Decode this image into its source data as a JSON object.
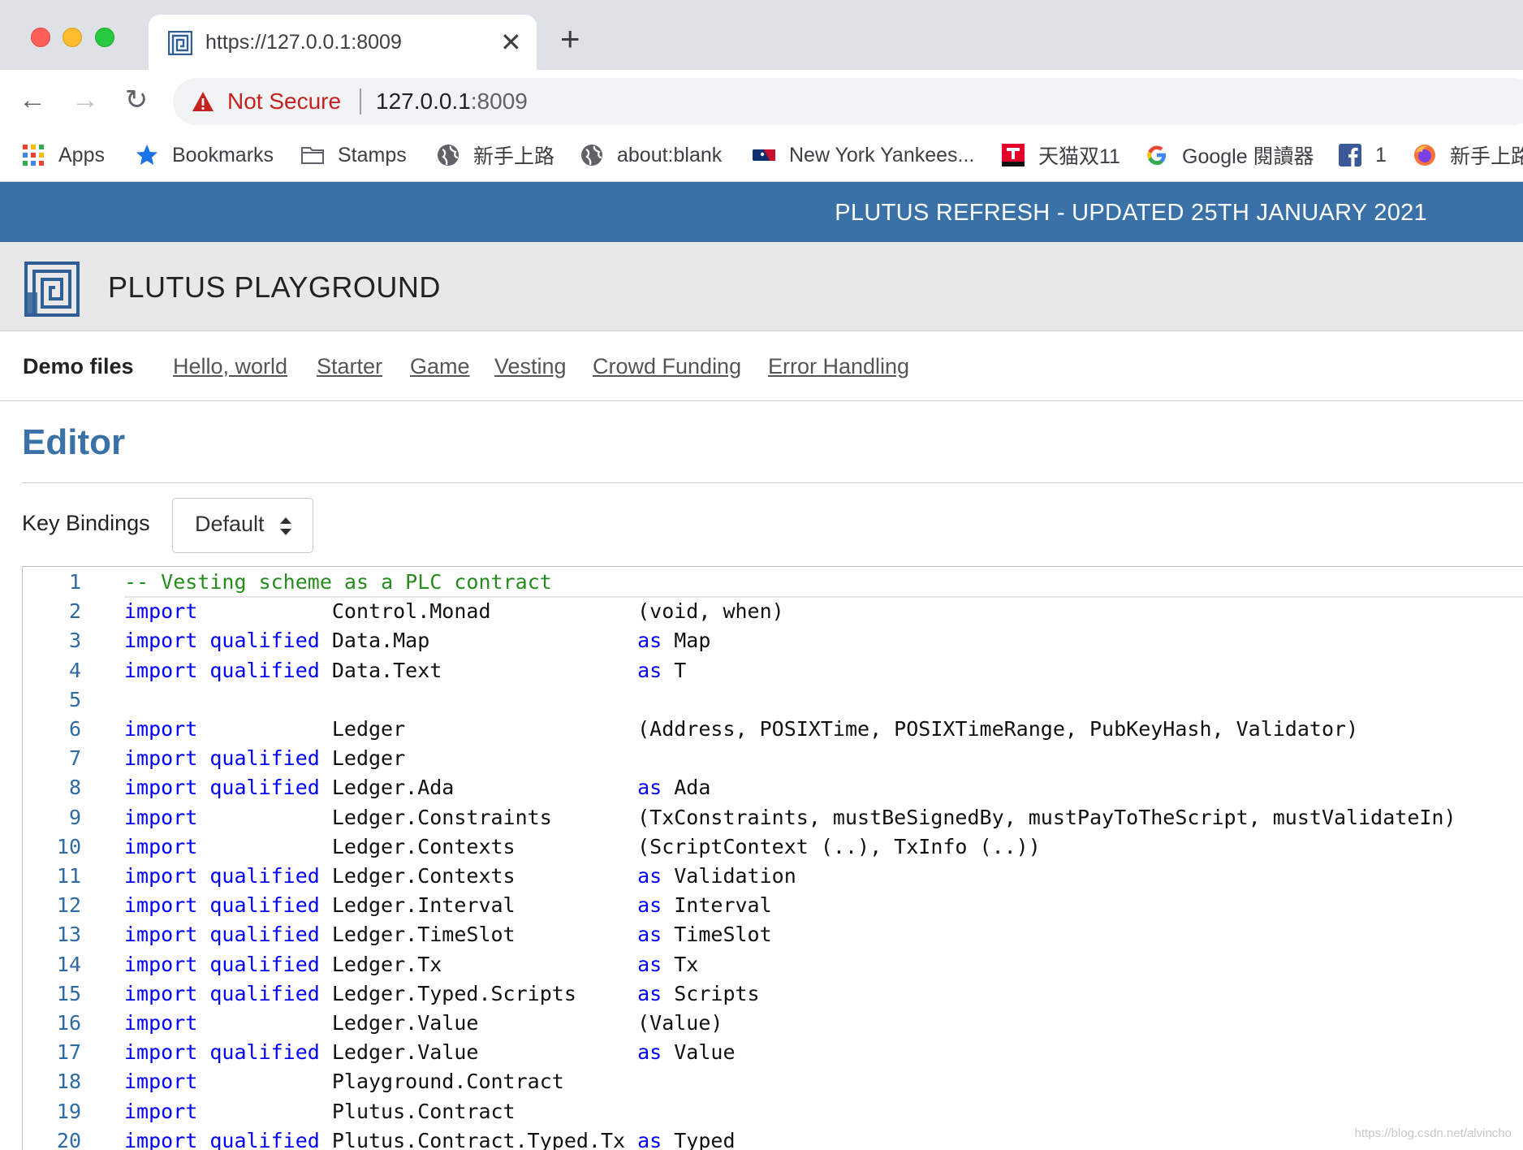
{
  "browser": {
    "tab_title": "https://127.0.0.1:8009",
    "tab_close_glyph": "✕",
    "new_tab_glyph": "+",
    "back_glyph": "←",
    "forward_glyph": "→",
    "reload_glyph": "↻",
    "security_label": "Not Secure",
    "url_host": "127.0.0.1",
    "url_port": ":8009",
    "bookmarks": [
      {
        "label": "Apps",
        "icon": "apps-grid-icon"
      },
      {
        "label": "Bookmarks",
        "icon": "star-icon"
      },
      {
        "label": "Stamps",
        "icon": "folder-icon"
      },
      {
        "label": "新手上路",
        "icon": "globe-icon"
      },
      {
        "label": "about:blank",
        "icon": "globe-icon"
      },
      {
        "label": "New York Yankees...",
        "icon": "mlb-icon"
      },
      {
        "label": "天猫双11",
        "icon": "tmall-icon"
      },
      {
        "label": "Google 閱讀器",
        "icon": "google-icon"
      },
      {
        "label": "1",
        "icon": "facebook-icon"
      },
      {
        "label": "新手上路",
        "icon": "firefox-icon"
      }
    ]
  },
  "banner": {
    "text": "PLUTUS REFRESH - UPDATED 25TH JANUARY 2021"
  },
  "header": {
    "title": "PLUTUS PLAYGROUND"
  },
  "demo": {
    "label": "Demo files",
    "links": [
      "Hello, world",
      "Starter",
      "Game",
      "Vesting",
      "Crowd Funding",
      "Error Handling"
    ]
  },
  "editor": {
    "heading": "Editor",
    "key_bindings_label": "Key Bindings",
    "key_bindings_value": "Default",
    "lines": [
      {
        "n": "1",
        "kw": "",
        "q": "",
        "mod": "",
        "rest": "",
        "comment": "-- Vesting scheme as a PLC contract"
      },
      {
        "n": "2",
        "kw": "import",
        "q": "",
        "mod": "Control.Monad",
        "restkw": "",
        "rest": "(void, when)"
      },
      {
        "n": "3",
        "kw": "import",
        "q": "qualified",
        "mod": "Data.Map",
        "restkw": "as",
        "rest": "Map"
      },
      {
        "n": "4",
        "kw": "import",
        "q": "qualified",
        "mod": "Data.Text",
        "restkw": "as",
        "rest": "T"
      },
      {
        "n": "5",
        "kw": "",
        "q": "",
        "mod": "",
        "restkw": "",
        "rest": ""
      },
      {
        "n": "6",
        "kw": "import",
        "q": "",
        "mod": "Ledger",
        "restkw": "",
        "rest": "(Address, POSIXTime, POSIXTimeRange, PubKeyHash, Validator)"
      },
      {
        "n": "7",
        "kw": "import",
        "q": "qualified",
        "mod": "Ledger",
        "restkw": "",
        "rest": ""
      },
      {
        "n": "8",
        "kw": "import",
        "q": "qualified",
        "mod": "Ledger.Ada",
        "restkw": "as",
        "rest": "Ada"
      },
      {
        "n": "9",
        "kw": "import",
        "q": "",
        "mod": "Ledger.Constraints",
        "restkw": "",
        "rest": "(TxConstraints, mustBeSignedBy, mustPayToTheScript, mustValidateIn)"
      },
      {
        "n": "10",
        "kw": "import",
        "q": "",
        "mod": "Ledger.Contexts",
        "restkw": "",
        "rest": "(ScriptContext (..), TxInfo (..))"
      },
      {
        "n": "11",
        "kw": "import",
        "q": "qualified",
        "mod": "Ledger.Contexts",
        "restkw": "as",
        "rest": "Validation"
      },
      {
        "n": "12",
        "kw": "import",
        "q": "qualified",
        "mod": "Ledger.Interval",
        "restkw": "as",
        "rest": "Interval"
      },
      {
        "n": "13",
        "kw": "import",
        "q": "qualified",
        "mod": "Ledger.TimeSlot",
        "restkw": "as",
        "rest": "TimeSlot"
      },
      {
        "n": "14",
        "kw": "import",
        "q": "qualified",
        "mod": "Ledger.Tx",
        "restkw": "as",
        "rest": "Tx"
      },
      {
        "n": "15",
        "kw": "import",
        "q": "qualified",
        "mod": "Ledger.Typed.Scripts",
        "restkw": "as",
        "rest": "Scripts"
      },
      {
        "n": "16",
        "kw": "import",
        "q": "",
        "mod": "Ledger.Value",
        "restkw": "",
        "rest": "(Value)"
      },
      {
        "n": "17",
        "kw": "import",
        "q": "qualified",
        "mod": "Ledger.Value",
        "restkw": "as",
        "rest": "Value"
      },
      {
        "n": "18",
        "kw": "import",
        "q": "",
        "mod": "Playground.Contract",
        "restkw": "",
        "rest": ""
      },
      {
        "n": "19",
        "kw": "import",
        "q": "",
        "mod": "Plutus.Contract",
        "restkw": "",
        "rest": ""
      },
      {
        "n": "20",
        "kw": "import",
        "q": "qualified",
        "mod": "Plutus.Contract.Typed.Tx",
        "restkw": "as",
        "rest": "Typed"
      }
    ]
  },
  "watermark": "https://blog.csdn.net/alvincho",
  "colors": {
    "banner": "#3a72a8",
    "keyword": "#0000ff",
    "comment": "#268c1e",
    "line_number": "#2d6aa6"
  }
}
